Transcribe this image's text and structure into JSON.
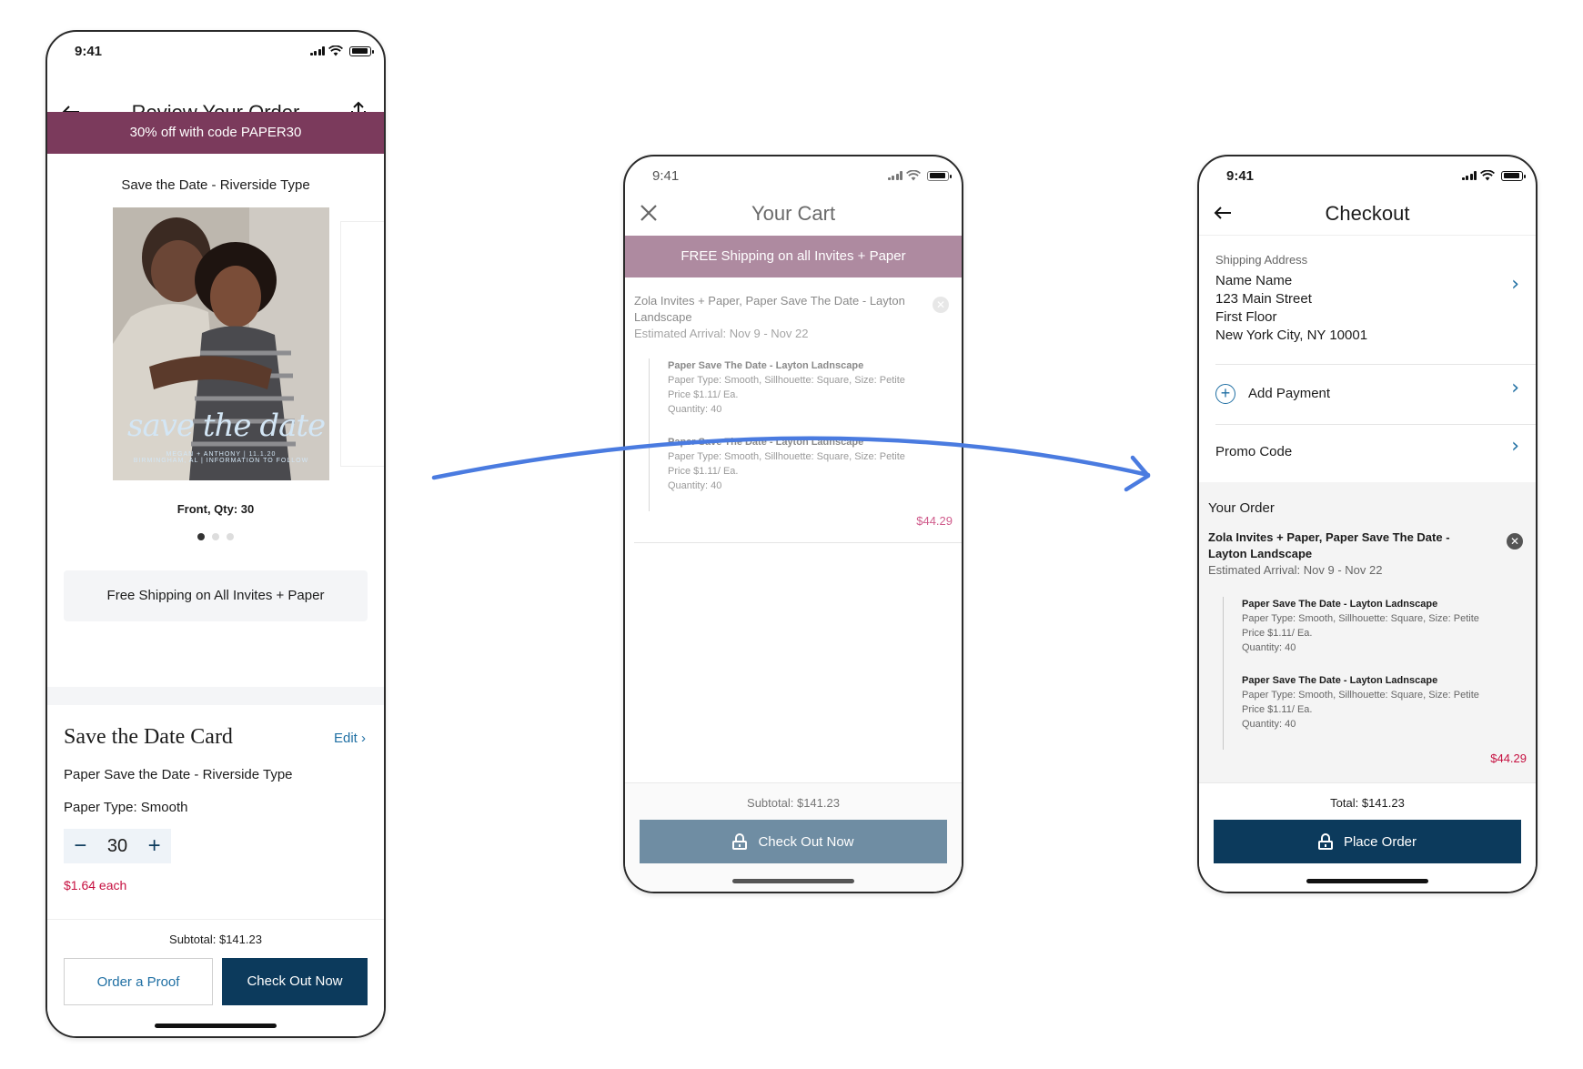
{
  "status_time": "9:41",
  "colors": {
    "promo_banner": "#7b3a5c",
    "shipping_banner": "#ae8aa0",
    "primary_button": "#0c3a5c",
    "disabled_button": "#6f8da3",
    "link": "#1f6fa3",
    "price_red": "#c61040",
    "price_pink": "#d05c8c",
    "arrow_blue": "#4a7be0"
  },
  "review": {
    "title": "Review Your Order",
    "promo_banner": "30% off with code PAPER30",
    "product_title": "Save the Date - Riverside Type",
    "card_script": "save the date",
    "card_names": "MEGAN + ANTHONY | 11.1.20",
    "card_place": "BIRMINGHAM, AL | INFORMATION TO FOLLOW",
    "front_qty": "Front, Qty: 30",
    "free_shipping": "Free Shipping on All Invites + Paper",
    "card_heading": "Save the Date Card",
    "edit_label": "Edit",
    "paper_name": "Paper Save the Date - Riverside Type",
    "paper_type": "Paper Type: Smooth",
    "quantity": "30",
    "price_each": "$1.64 each",
    "subtotal": "Subtotal: $141.23",
    "order_proof": "Order a Proof",
    "checkout": "Check Out Now"
  },
  "cart": {
    "title": "Your Cart",
    "banner": "FREE Shipping on all Invites + Paper",
    "item_title": "Zola Invites + Paper, Paper Save The Date - Layton Landscape",
    "arrival": "Estimated Arrival: Nov 9 - Nov 22",
    "sub_items": [
      {
        "name": "Paper Save The Date - Layton Ladnscape",
        "details": "Paper Type: Smooth, Sillhouette: Square, Size: Petite",
        "price": "Price $1.11/ Ea.",
        "qty": "Quantity: 40"
      },
      {
        "name": "Paper Save The Date - Layton Ladnscape",
        "details": "Paper Type: Smooth, Sillhouette: Square, Size: Petite",
        "price": "Price $1.11/ Ea.",
        "qty": "Quantity: 40"
      }
    ],
    "line_total": "$44.29",
    "subtotal": "Subtotal: $141.23",
    "checkout": "Check Out Now"
  },
  "checkout": {
    "title": "Checkout",
    "shipping_label": "Shipping Address",
    "address": [
      "Name Name",
      "123 Main Street",
      "First Floor",
      "New York City, NY 10001"
    ],
    "add_payment": "Add Payment",
    "promo_code": "Promo Code",
    "order_title": "Your Order",
    "item_title": "Zola Invites + Paper, Paper Save The Date - Layton Landscape",
    "arrival": "Estimated Arrival: Nov 9 - Nov 22",
    "sub_items": [
      {
        "name": "Paper Save The Date - Layton Ladnscape",
        "details": "Paper Type: Smooth, Sillhouette: Square, Size: Petite",
        "price": "Price $1.11/ Ea.",
        "qty": "Quantity: 40"
      },
      {
        "name": "Paper Save The Date - Layton Ladnscape",
        "details": "Paper Type: Smooth, Sillhouette: Square, Size: Petite",
        "price": "Price $1.11/ Ea.",
        "qty": "Quantity: 40"
      }
    ],
    "line_total": "$44.29",
    "total": "Total: $141.23",
    "place_order": "Place Order"
  }
}
